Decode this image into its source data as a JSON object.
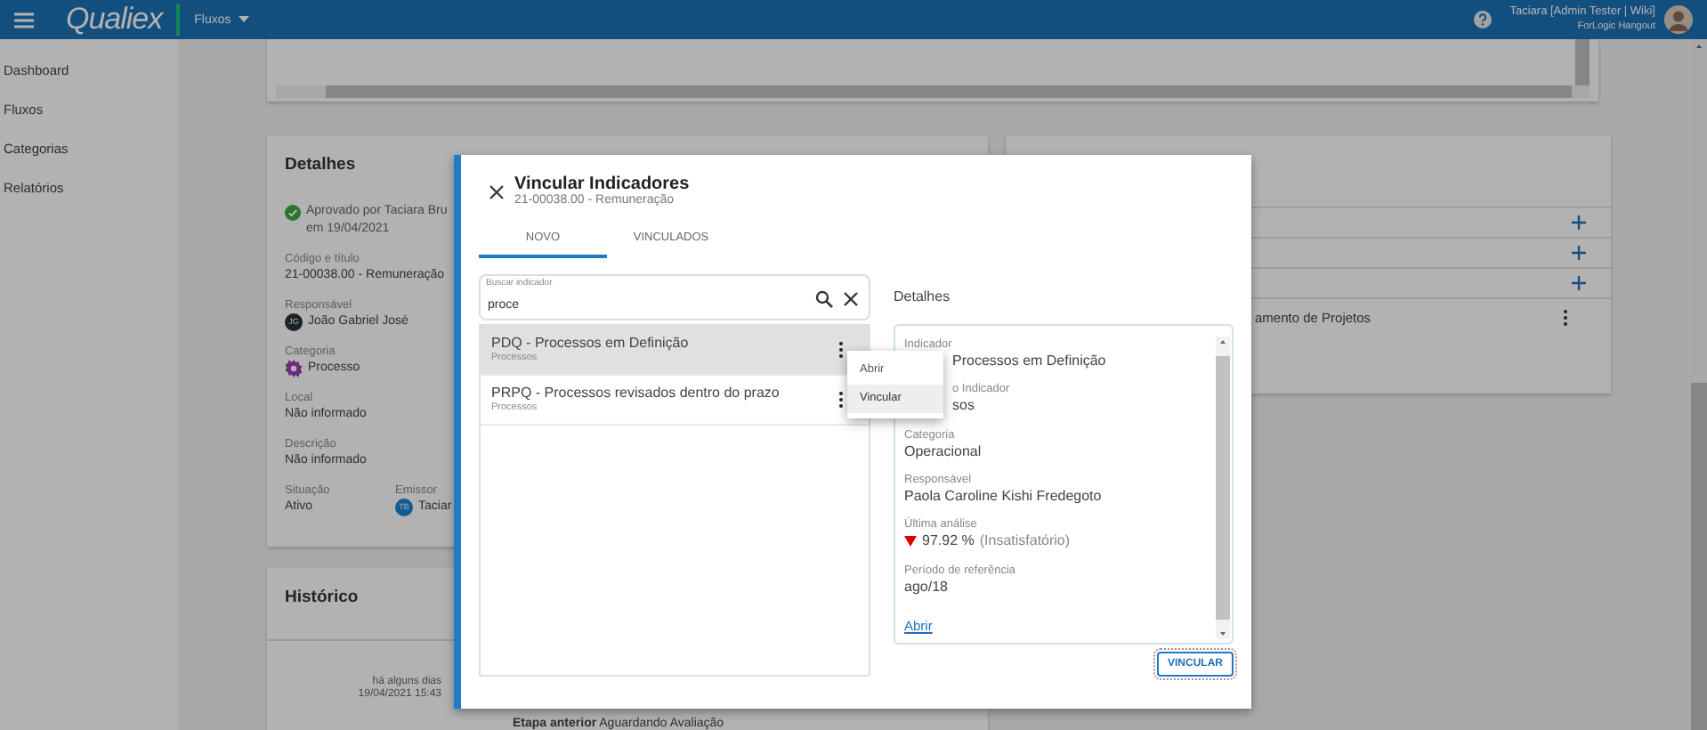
{
  "topbar": {
    "app_name": "Qualiex",
    "module": "Fluxos",
    "user_name": "Taciara [Admin Tester | Wiki]",
    "user_org": "ForLogic Hangout"
  },
  "sidebar": {
    "items": [
      "Dashboard",
      "Fluxos",
      "Categorias",
      "Relatórios"
    ]
  },
  "details_card": {
    "title": "Detalhes",
    "approval": "Aprovado por Taciara Bru",
    "approval_date": "em 19/04/2021",
    "fields": [
      {
        "kind": "text",
        "label": "Código e título",
        "value": "21-00038.00 - Remuneração"
      },
      {
        "kind": "person",
        "label": "Responsável",
        "value": "João Gabriel José",
        "initials": "JG",
        "color": "#1b2327"
      },
      {
        "kind": "category",
        "label": "Categoria",
        "value": "Processo"
      },
      {
        "kind": "text",
        "label": "Local",
        "value": "Não informado"
      },
      {
        "kind": "text",
        "label": "Descrição",
        "value": "Não informado"
      }
    ],
    "footer": [
      {
        "kind": "text",
        "label": "Situação",
        "value": "Ativo"
      },
      {
        "kind": "person",
        "label": "Emissor",
        "value": "Taciar",
        "initials": "TB",
        "color": "#135b92"
      }
    ]
  },
  "history_card": {
    "title": "Histórico",
    "when": "há alguns dias",
    "date": "19/04/2021 15:43",
    "step": "**Etapa anterior** Aguardando Avaliação"
  },
  "side_card": {
    "rows": [
      {
        "kind": "add"
      },
      {
        "kind": "add"
      },
      {
        "kind": "add"
      },
      {
        "kind": "item",
        "text": "amento de Projetos"
      }
    ]
  },
  "modal": {
    "title": "Vincular Indicadores",
    "subtitle": "21-00038.00 - Remuneração",
    "tabs": [
      {
        "label": "NOVO",
        "selected": true
      },
      {
        "label": "VINCULADOS",
        "selected": false
      }
    ],
    "search": {
      "label": "Buscar indicador",
      "value": "proce"
    },
    "results": [
      {
        "title": "PDQ - Processos em Definição",
        "subtitle": "Processos",
        "selected": true
      },
      {
        "title": "PRPQ - Processos revisados dentro do prazo",
        "subtitle": "Processos",
        "selected": false
      }
    ],
    "menu": [
      {
        "label": "Abrir",
        "highlighted": false
      },
      {
        "label": "Vincular",
        "highlighted": true
      }
    ],
    "details": {
      "heading": "Detalhes",
      "fields": [
        {
          "kind": "value_under_menu",
          "label": "Indicador",
          "value": "Processos em Definição"
        },
        {
          "kind": "under_menu",
          "label": "o Indicador",
          "value": "sos"
        },
        {
          "kind": "plain",
          "label": "Categoria",
          "value": "Operacional"
        },
        {
          "kind": "plain",
          "label": "Responsável",
          "value": "Paola Caroline Kishi Fredegoto"
        },
        {
          "kind": "analysis",
          "label": "Última análise",
          "value": "97.92 %",
          "note": "(Insatisfatório)",
          "below_target": true
        },
        {
          "kind": "plain",
          "label": "Período de referência",
          "value": "ago/18"
        }
      ],
      "link": "Abrir"
    },
    "button": "VINCULAR"
  }
}
